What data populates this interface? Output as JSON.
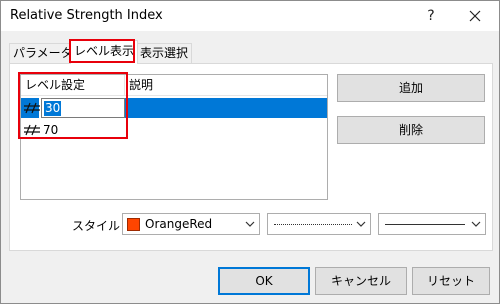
{
  "window": {
    "title": "Relative Strength Index",
    "help_glyph": "?"
  },
  "tabs": [
    {
      "label": "パラメーター"
    },
    {
      "label": "レベル表示"
    },
    {
      "label": "表示選択"
    }
  ],
  "levels": {
    "columns": [
      "レベル設定",
      "説明"
    ],
    "rows": [
      {
        "value": "30",
        "description": "",
        "selected": true
      },
      {
        "value": "70",
        "description": "",
        "selected": false
      }
    ]
  },
  "buttons": {
    "add": "追加",
    "delete": "削除",
    "ok": "OK",
    "cancel": "キャンセル",
    "reset": "リセット"
  },
  "style": {
    "label": "スタイル :",
    "color_name": "OrangeRed",
    "color_hex": "#ff4500",
    "line_style": "dotted",
    "line_width": "thin"
  },
  "accent": {
    "annotation": "#e8000b",
    "selection": "#0078d7"
  }
}
